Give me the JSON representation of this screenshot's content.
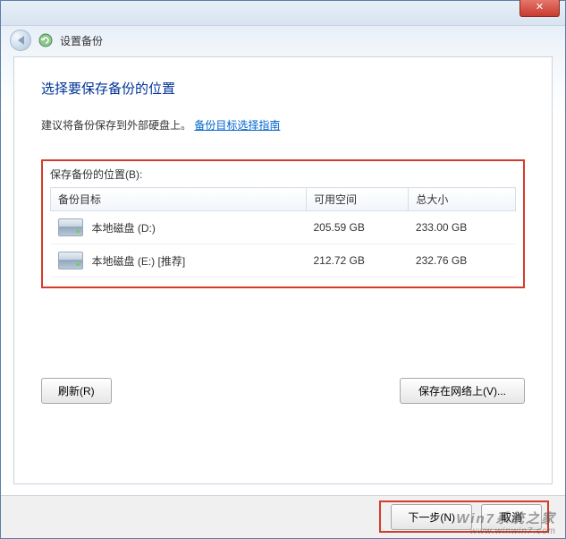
{
  "titlebar": {
    "close_glyph": "✕"
  },
  "navbar": {
    "title": "设置备份"
  },
  "page": {
    "heading": "选择要保存备份的位置",
    "instruction": "建议将备份保存到外部硬盘上。",
    "guideline_link": "备份目标选择指南"
  },
  "list": {
    "label": "保存备份的位置(B):",
    "columns": {
      "target": "备份目标",
      "free": "可用空间",
      "total": "总大小"
    },
    "rows": [
      {
        "name": "本地磁盘 (D:)",
        "free": "205.59 GB",
        "total": "233.00 GB"
      },
      {
        "name": "本地磁盘 (E:) [推荐]",
        "free": "212.72 GB",
        "total": "232.76 GB"
      }
    ]
  },
  "buttons": {
    "refresh": "刷新(R)",
    "save_network": "保存在网络上(V)...",
    "next": "下一步(N)",
    "cancel": "取消"
  },
  "watermark": {
    "line1": "Win7系统之家",
    "line2": "www.winwin7.com"
  }
}
